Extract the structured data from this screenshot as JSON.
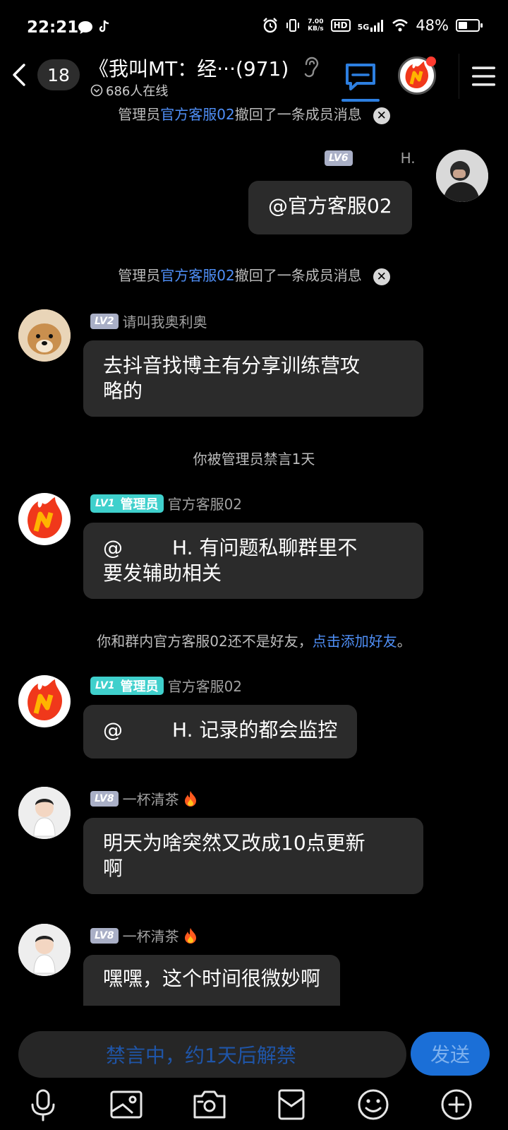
{
  "status_bar": {
    "time": "22:21",
    "speed_value": "7.00",
    "speed_unit": "KB/s",
    "hd": "HD",
    "network": "5G",
    "battery": "48%"
  },
  "header": {
    "unread_count": "18",
    "title": "《我叫MT：经···(971)",
    "online": "686人在线"
  },
  "messages": {
    "sys_recall_1": {
      "prefix": "管理员",
      "name": "官方客服02",
      "suffix": "撤回了一条成员消息"
    },
    "self_msg": {
      "level": "LV6",
      "name": "H.",
      "text": "@官方客服02"
    },
    "sys_recall_2": {
      "prefix": "管理员",
      "name": "官方客服02",
      "suffix": "撤回了一条成员消息"
    },
    "msg_1": {
      "level": "LV2",
      "name": "请叫我奥利奥",
      "text_line1": "去抖音找博主有分享训练营攻",
      "text_line2": "略的"
    },
    "sys_mute": "你被管理员禁言1天",
    "msg_2": {
      "level": "LV1",
      "role": "管理员",
      "name": "官方客服02",
      "at": "@",
      "line1_rest": "H. 有问题私聊群里不",
      "line2": "要发辅助相关"
    },
    "sys_friend": {
      "text": "你和群内官方客服02还不是好友，",
      "link": "点击添加好友",
      "end": "。"
    },
    "msg_3": {
      "level": "LV1",
      "role": "管理员",
      "name": "官方客服02",
      "at": "@",
      "rest": "H. 记录的都会监控"
    },
    "msg_4": {
      "level": "LV8",
      "name": "一杯清茶",
      "text_line1": "明天为啥突然又改成10点更新",
      "text_line2": "啊"
    },
    "msg_5": {
      "level": "LV8",
      "name": "一杯清茶",
      "text": "嘿嘿，这个时间很微妙啊"
    }
  },
  "input": {
    "muted_text": "禁言中，约1天后解禁",
    "send_label": "发送"
  },
  "colors": {
    "accent_blue": "#2d7fe0",
    "admin_tag": "#3fd0cc",
    "bubble": "#2b2b2b"
  }
}
